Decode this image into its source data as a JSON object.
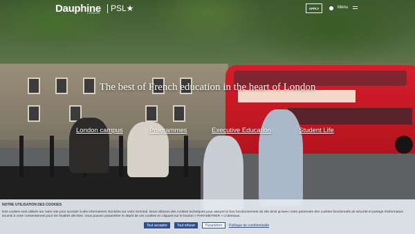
{
  "header": {
    "logo_name": "Dauphine",
    "logo_sub": "LONDON",
    "logo_psl": "PSL★",
    "apply_label": "APPLY",
    "globe_icon": "globe-icon",
    "menu_label": "Menu",
    "menu_icon": "hamburger-icon"
  },
  "hero": {
    "title": "The best of French education in the heart of London",
    "links": [
      "London campus",
      "Programmes",
      "Executive Education",
      "Student Life"
    ]
  },
  "cookie": {
    "title": "NOTRE UTILISATION DES COOKIES",
    "text": "Des cookies sont utilisés sur notre site pour accéder à des informations stockées sur votre terminal. Nous utilisons des cookies techniques pour assurer le bon fonctionnement du site ainsi qu'avec notre partenaire des cookies fonctionnels de sécurité et partage d'information soumis à votre consentement pour les finalités décrites. Vous pouvez paramétrer le dépôt de ces cookies en cliquant sur le bouton « PARAMETRER » ci-dessous.",
    "accept_label": "Tout accepter",
    "refuse_label": "Tout refuser",
    "settings_label": "Paramétrer",
    "policy_label": "Politique de confidentialité"
  }
}
